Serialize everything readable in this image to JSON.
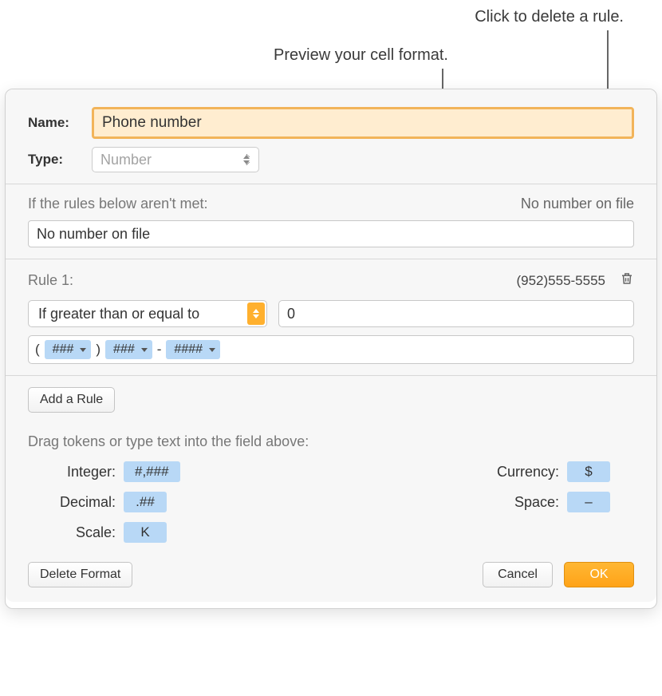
{
  "annotations": {
    "delete": "Click to delete a rule.",
    "preview": "Preview your cell format."
  },
  "name_label": "Name:",
  "name_value": "Phone number",
  "type_label": "Type:",
  "type_value": "Number",
  "rules_unmet_label": "If the rules below aren't met:",
  "rules_unmet_preview": "No number on file",
  "rules_unmet_value": "No number on file",
  "rule1_label": "Rule 1:",
  "rule1_preview": "(952)555-5555",
  "condition_label": "If greater than or equal to",
  "condition_value": "0",
  "format_tokens": {
    "open": "(",
    "t1": "###",
    "close": ")",
    "t2": "###",
    "dash": "-",
    "t3": "####"
  },
  "add_rule": "Add a Rule",
  "drag_hint": "Drag tokens or type text into the field above:",
  "legend": {
    "integer_label": "Integer:",
    "integer_token": "#,###",
    "decimal_label": "Decimal:",
    "decimal_token": ".##",
    "scale_label": "Scale:",
    "scale_token": "K",
    "currency_label": "Currency:",
    "currency_token": "$",
    "space_label": "Space:",
    "space_token": "–"
  },
  "delete_format": "Delete Format",
  "cancel": "Cancel",
  "ok": "OK"
}
